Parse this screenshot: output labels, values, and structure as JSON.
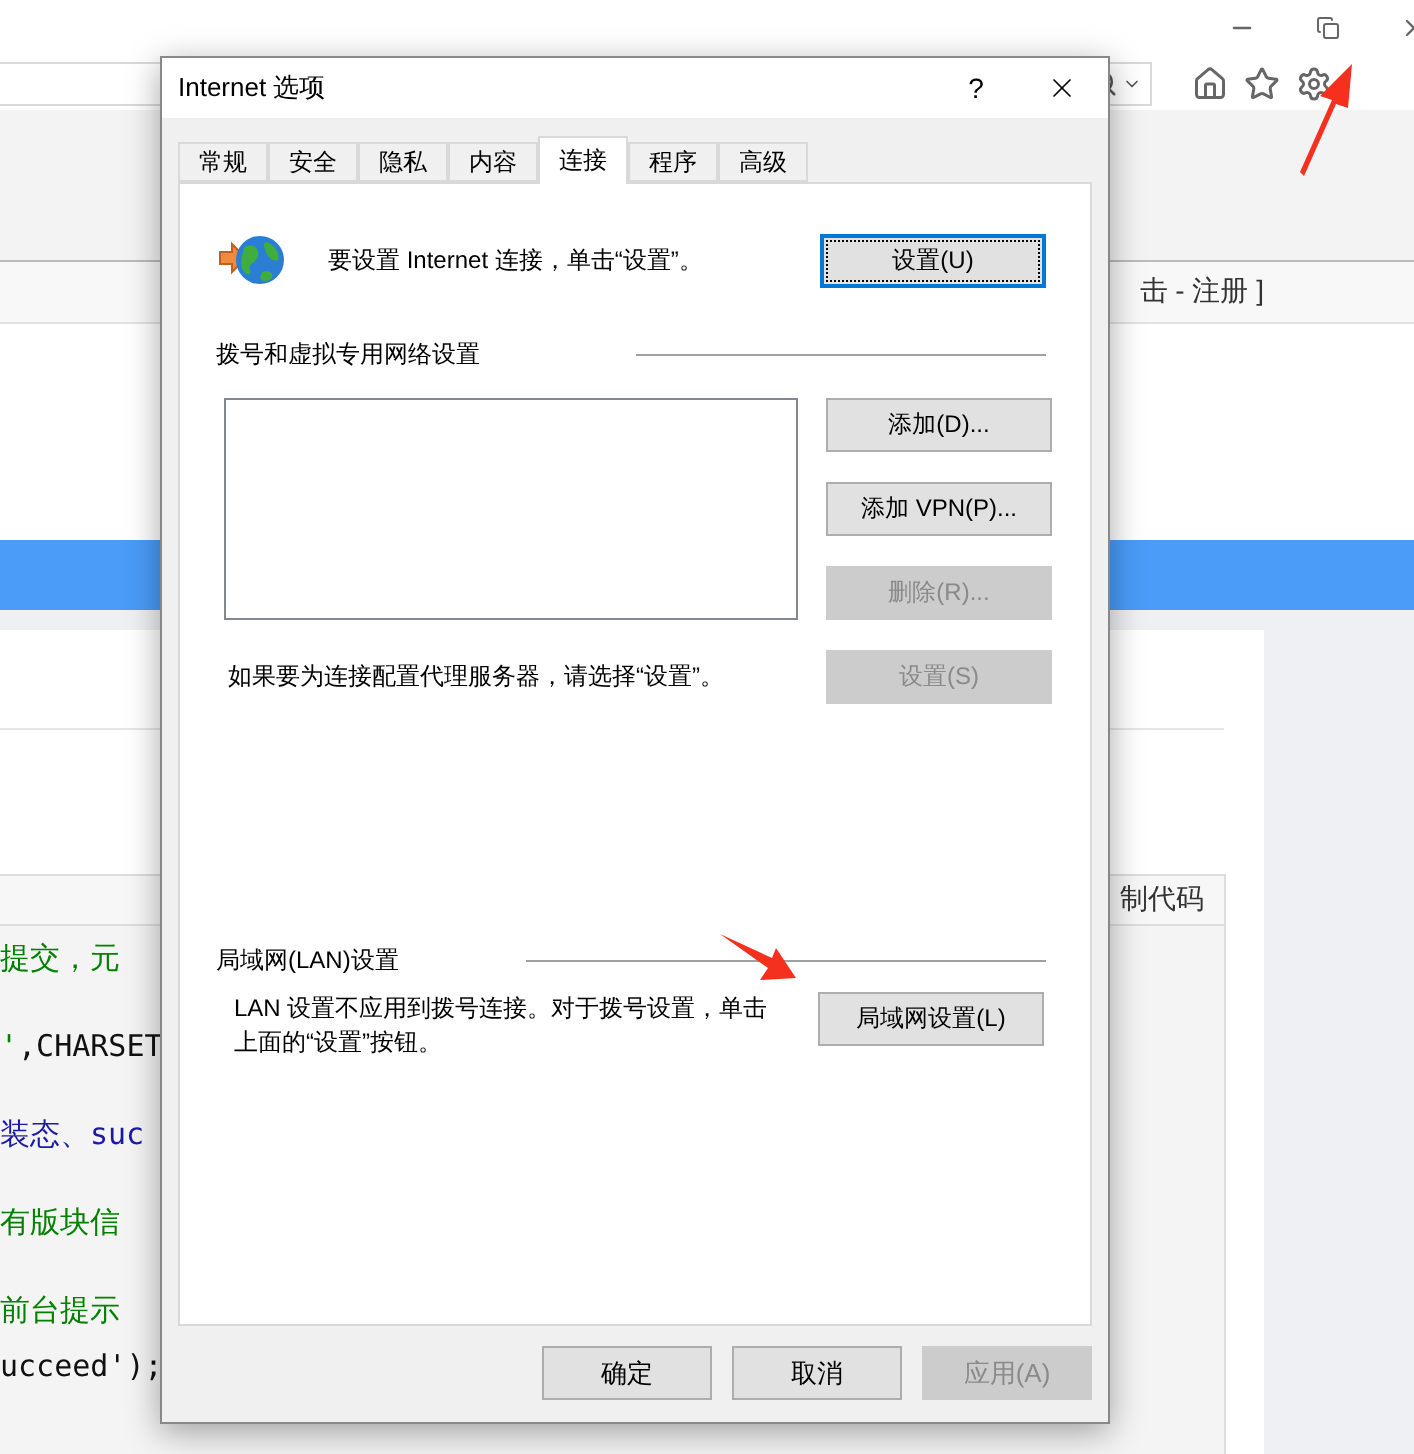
{
  "browser": {
    "header_link_text": "击 - 注册 ]",
    "copy_code_label": "制代码",
    "code_groups": [
      [
        [
          {
            "kind": "comment",
            "text": "提交，元"
          }
        ]
      ],
      [
        [
          {
            "kind": "comment",
            "text": "'"
          },
          {
            "kind": "plain",
            "text": ",CHARSET"
          }
        ]
      ],
      [
        [
          {
            "kind": "keyword",
            "text": "装态、suc"
          }
        ]
      ],
      [
        [
          {
            "kind": "comment",
            "text": "有版块信"
          }
        ]
      ],
      [
        [
          {
            "kind": "comment",
            "text": "前台提示"
          }
        ],
        [
          {
            "kind": "plain",
            "text": "ucceed');"
          }
        ]
      ]
    ]
  },
  "dialog": {
    "title": "Internet 选项",
    "help": "?",
    "tabs": [
      {
        "label": "常规",
        "selected": false
      },
      {
        "label": "安全",
        "selected": false
      },
      {
        "label": "隐私",
        "selected": false
      },
      {
        "label": "内容",
        "selected": false
      },
      {
        "label": "连接",
        "selected": true
      },
      {
        "label": "程序",
        "selected": false
      },
      {
        "label": "高级",
        "selected": false
      }
    ],
    "intro_text": "要设置 Internet 连接，单击“设置”。",
    "setup_button": {
      "label": "设置(U)",
      "focused": true
    },
    "dialup_section_title": "拨号和虚拟专用网络设置",
    "dialup_buttons": [
      {
        "label": "添加(D)...",
        "disabled": false
      },
      {
        "label": "添加 VPN(P)...",
        "disabled": false
      },
      {
        "label": "删除(R)...",
        "disabled": true
      },
      {
        "label": "设置(S)",
        "disabled": true
      }
    ],
    "proxy_text": "如果要为连接配置代理服务器，请选择“设置”。",
    "lan_section_title": "局域网(LAN)设置",
    "lan_text": "LAN 设置不应用到拨号连接。对于拨号设置，单击上面的“设置”按钮。",
    "lan_button": {
      "label": "局域网设置(L)",
      "disabled": false
    },
    "footer_buttons": [
      {
        "label": "确定",
        "disabled": false
      },
      {
        "label": "取消",
        "disabled": false
      },
      {
        "label": "应用(A)",
        "disabled": true
      }
    ]
  }
}
